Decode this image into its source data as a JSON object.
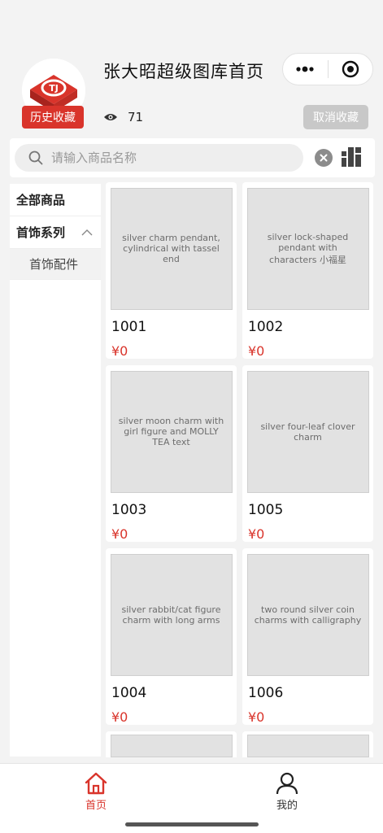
{
  "header": {
    "title": "张大昭超级图库首页",
    "history_label": "历史收藏",
    "view_count": "71",
    "cancel_fav_label": "取消收藏"
  },
  "capsule": {
    "more_icon": "more-dots-icon",
    "close_icon": "target-circle-icon"
  },
  "search": {
    "placeholder": "请输入商品名称",
    "value": ""
  },
  "sidebar": {
    "all_label": "全部商品",
    "category_label": "首饰系列",
    "sub_label": "首饰配件"
  },
  "products": [
    {
      "name": "1001",
      "price": "¥0",
      "image": "silver charm pendant, cylindrical with tassel end"
    },
    {
      "name": "1002",
      "price": "¥0",
      "image": "silver lock-shaped pendant with characters 小福星"
    },
    {
      "name": "1003",
      "price": "¥0",
      "image": "silver moon charm with girl figure and MOLLY TEA text"
    },
    {
      "name": "1005",
      "price": "¥0",
      "image": "silver four-leaf clover charm"
    },
    {
      "name": "1004",
      "price": "¥0",
      "image": "silver rabbit/cat figure charm with long arms"
    },
    {
      "name": "1006",
      "price": "¥0",
      "image": "two round silver coin charms with calligraphy"
    }
  ],
  "tabbar": {
    "home_label": "首页",
    "mine_label": "我的"
  },
  "colors": {
    "accent": "#d9342b",
    "disabled": "#c8c8c8",
    "background": "#f3f3f3"
  }
}
